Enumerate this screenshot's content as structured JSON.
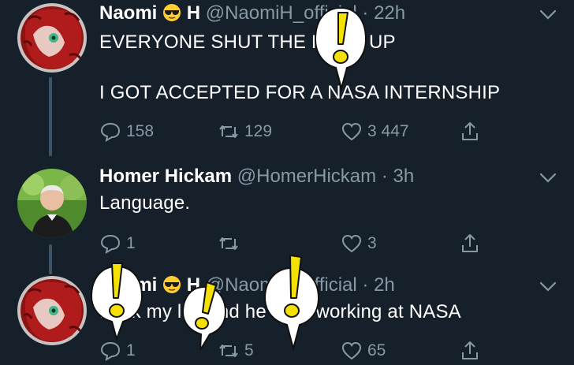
{
  "tweets": [
    {
      "name": "Naomi",
      "name_suffix": "H",
      "handle": "@NaomiH_official",
      "sep": "·",
      "time": "22h",
      "text": "EVERYONE SHUT THE FUCK UP\n\nI GOT ACCEPTED FOR A NASA INTERNSHIP",
      "replies": "158",
      "retweets": "129",
      "likes": "3 447"
    },
    {
      "name": "Homer Hickam",
      "handle": "@HomerHickam",
      "sep": "·",
      "time": "3h",
      "text": "Language.",
      "replies": "1",
      "retweets": "",
      "likes": "3"
    },
    {
      "name": "Naomi",
      "name_suffix": "H",
      "handle": "@NaomiH_official",
      "sep": "·",
      "time": "2h",
      "text": "Fuck my life and he's I'm working at NASA",
      "replies": "1",
      "retweets": "5",
      "likes": "65"
    }
  ],
  "colors": {
    "background": "#15202b",
    "secondary_text": "#8899a6",
    "thread_line": "#3d5466",
    "alert_yellow": "#f5e003"
  },
  "icons": [
    "reply-icon",
    "retweet-icon",
    "like-icon",
    "share-icon",
    "chevron-down-icon",
    "sunglasses-emoji",
    "exclamation-speech-bubble"
  ]
}
